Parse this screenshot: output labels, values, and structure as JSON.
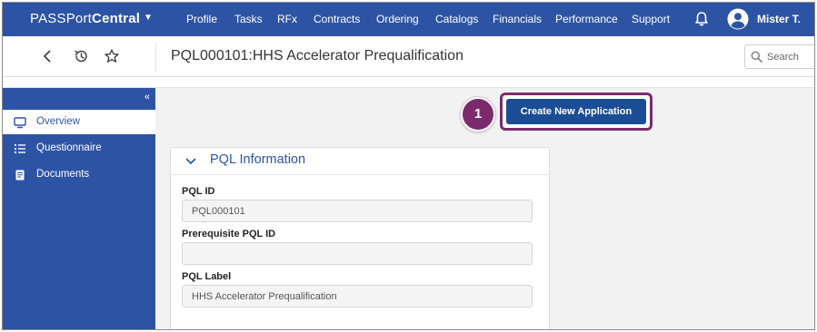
{
  "nav": {
    "brand_part1": "PASSPort",
    "brand_part2": "Central",
    "items": [
      "Profile",
      "Tasks",
      "RFx",
      "Contracts",
      "Ordering",
      "Catalogs",
      "Financials",
      "Performance",
      "Support"
    ],
    "user": "Mister T."
  },
  "header": {
    "title": "PQL000101:HHS Accelerator Prequalification",
    "search_placeholder": "Search"
  },
  "sidebar": {
    "items": [
      {
        "label": "Overview",
        "icon": "monitor-icon",
        "active": true
      },
      {
        "label": "Questionnaire",
        "icon": "list-icon",
        "active": false
      },
      {
        "label": "Documents",
        "icon": "document-icon",
        "active": false
      }
    ]
  },
  "main": {
    "step_number": "1",
    "create_button": "Create New Application"
  },
  "pql": {
    "section_title": "PQL Information",
    "fields": [
      {
        "label": "PQL ID",
        "value": "PQL000101"
      },
      {
        "label": "Prerequisite PQL ID",
        "value": ""
      },
      {
        "label": "PQL Label",
        "value": "HHS Accelerator Prequalification"
      }
    ]
  },
  "colors": {
    "nav_blue": "#2d54a4",
    "button_blue": "#1a4d96",
    "highlight_purple": "#7c2a6e"
  }
}
